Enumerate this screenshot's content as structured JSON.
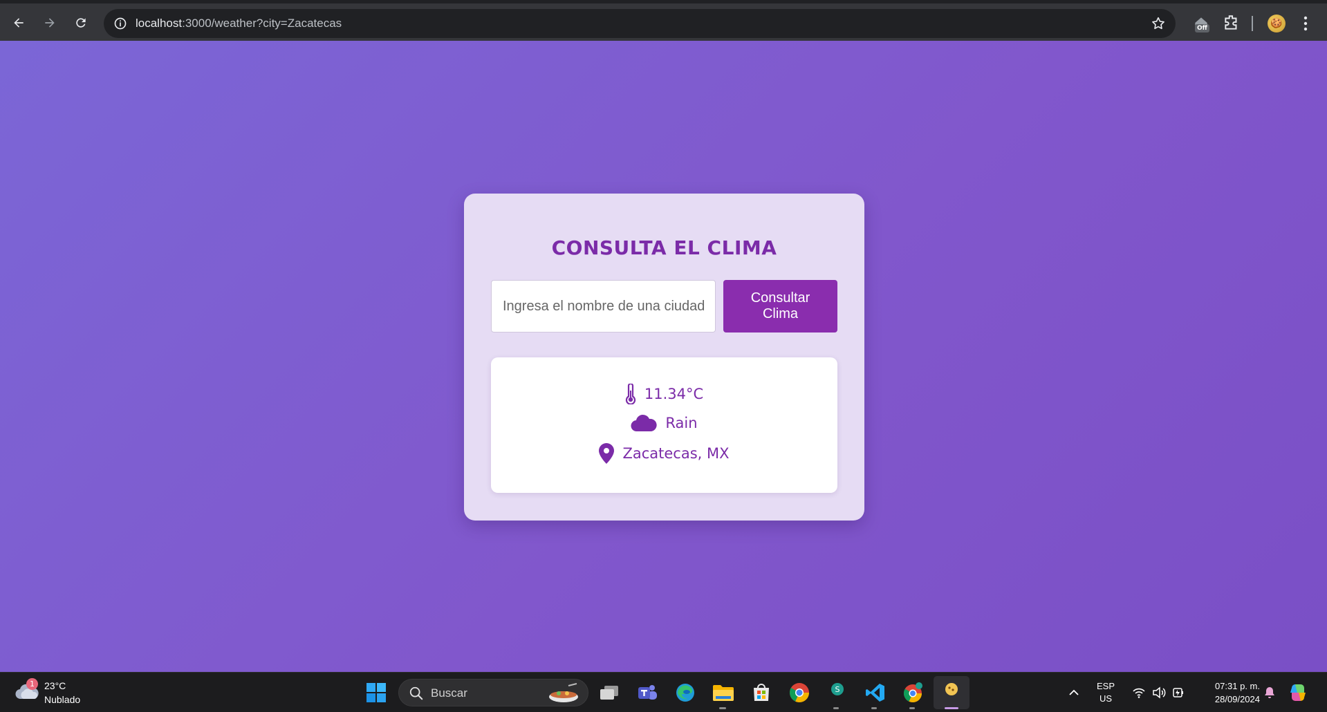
{
  "browser": {
    "url_host": "localhost",
    "url_path": ":3000/weather?city=Zacatecas",
    "extension_badge": "Off"
  },
  "app": {
    "title": "CONSULTA EL CLIMA",
    "input_placeholder": "Ingresa el nombre de una ciudad",
    "submit_label": "Consultar\nClima",
    "result": {
      "temperature": "11.34°C",
      "condition": "Rain",
      "location": "Zacatecas, MX"
    },
    "colors": {
      "accent": "#7b2ba8",
      "button": "#8a2dae",
      "card_bg": "#e6dcf4",
      "page_gradient_start": "#7b66d6",
      "page_gradient_end": "#7a4fc6"
    }
  },
  "taskbar": {
    "weather_badge": "1",
    "weather_temp": "23°C",
    "weather_desc": "Nublado",
    "search_label": "Buscar",
    "apps": [
      "task-view-icon",
      "teams-icon",
      "edge-icon",
      "file-explorer-icon",
      "microsoft-store-icon",
      "chrome-icon",
      "sticky-app-icon",
      "vscode-icon",
      "chrome-dev-icon",
      "chrome-profile-icon"
    ],
    "lang_primary": "ESP",
    "lang_secondary": "US",
    "time": "07:31 p. m.",
    "date": "28/09/2024"
  }
}
